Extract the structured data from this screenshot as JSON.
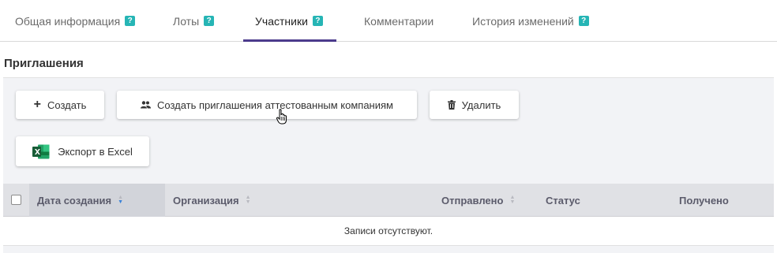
{
  "tabs": [
    {
      "label": "Общая информация",
      "help": "?"
    },
    {
      "label": "Лоты",
      "help": "?"
    },
    {
      "label": "Участники",
      "help": "?"
    },
    {
      "label": "Комментарии"
    },
    {
      "label": "История изменений",
      "help": "?"
    }
  ],
  "active_tab": "Участники",
  "section": {
    "title": "Приглашения"
  },
  "toolbar": {
    "create_label": "Создать",
    "invite_label": "Создать приглашения аттестованным компаниям",
    "delete_label": "Удалить",
    "export_label": "Экспорт в Excel"
  },
  "table": {
    "columns": [
      "Дата создания",
      "Организация",
      "Отправлено",
      "Статус",
      "Получено"
    ],
    "sorted_column": "Дата создания",
    "empty_text": "Записи отсутствуют."
  },
  "colors": {
    "accent_tab": "#4b3b8c",
    "help_badge": "#26b5b5",
    "excel_green": "#1d7a45",
    "sort_active": "#3b82d8"
  },
  "icons": {
    "create": "plus-icon",
    "invite": "users-icon",
    "delete": "trash-icon",
    "export": "excel-icon"
  }
}
